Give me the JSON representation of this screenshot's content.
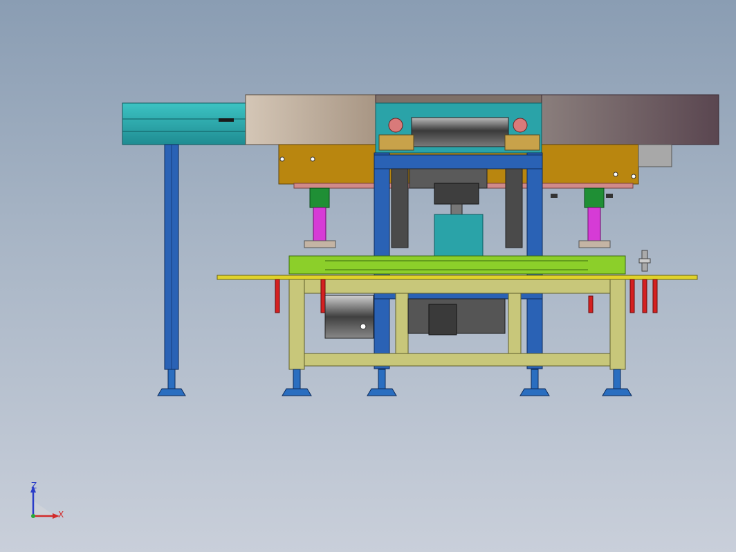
{
  "viewport": {
    "background_top": "#8a9db3",
    "background_bottom": "#c9cfda"
  },
  "model": {
    "description_icon": "cad-assembly-front-view",
    "colors": {
      "teal": "#2aa3a8",
      "steel_blue": "#2a62b5",
      "brown": "#b9860f",
      "lime": "#8ccf2a",
      "magenta": "#d63bd6",
      "green": "#1f8f35",
      "olive": "#c8c77a",
      "red": "#d42020",
      "gray_dark": "#4a4a4a",
      "cover_left": "#c8b8a8",
      "cover_right": "#6e5a62"
    }
  },
  "triad": {
    "z_label": "Z",
    "x_label": "X",
    "z_color": "#2a3cc8",
    "x_color": "#d22a2a",
    "origin_color": "#2aa83a"
  }
}
